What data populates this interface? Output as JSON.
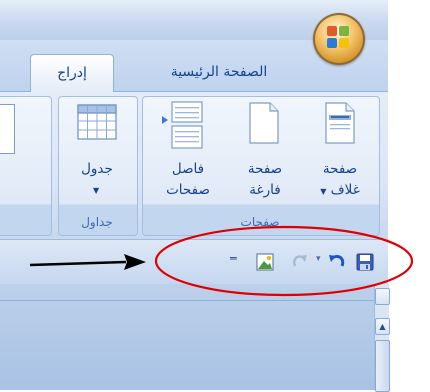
{
  "tabs": {
    "insert": "إدراج",
    "home": "الصفحة الرئيسية"
  },
  "groups": {
    "pages": {
      "label": "صفحات",
      "cover_page": {
        "line1": "صفحة",
        "line2": "غلاف",
        "has_dropdown": true
      },
      "blank_page": {
        "line1": "صفحة",
        "line2": "فارغة"
      },
      "page_break": {
        "line1": "فاصل",
        "line2": "صفحات"
      }
    },
    "tables": {
      "label": "جداول",
      "table": {
        "label": "جدول",
        "has_dropdown": true
      }
    }
  },
  "quick_access": {
    "items": [
      "save-icon",
      "undo-icon",
      "undo-dropdown-icon",
      "redo-icon",
      "insert-picture-icon",
      "customize-toolbar-icon"
    ]
  },
  "annotation": {
    "arrow": "arrow-icon",
    "ellipse_color": "#e00000"
  },
  "colors": {
    "ribbon_text": "#15428b",
    "ribbon_bg": "#dbe6f5",
    "highlight": "#e00000"
  }
}
